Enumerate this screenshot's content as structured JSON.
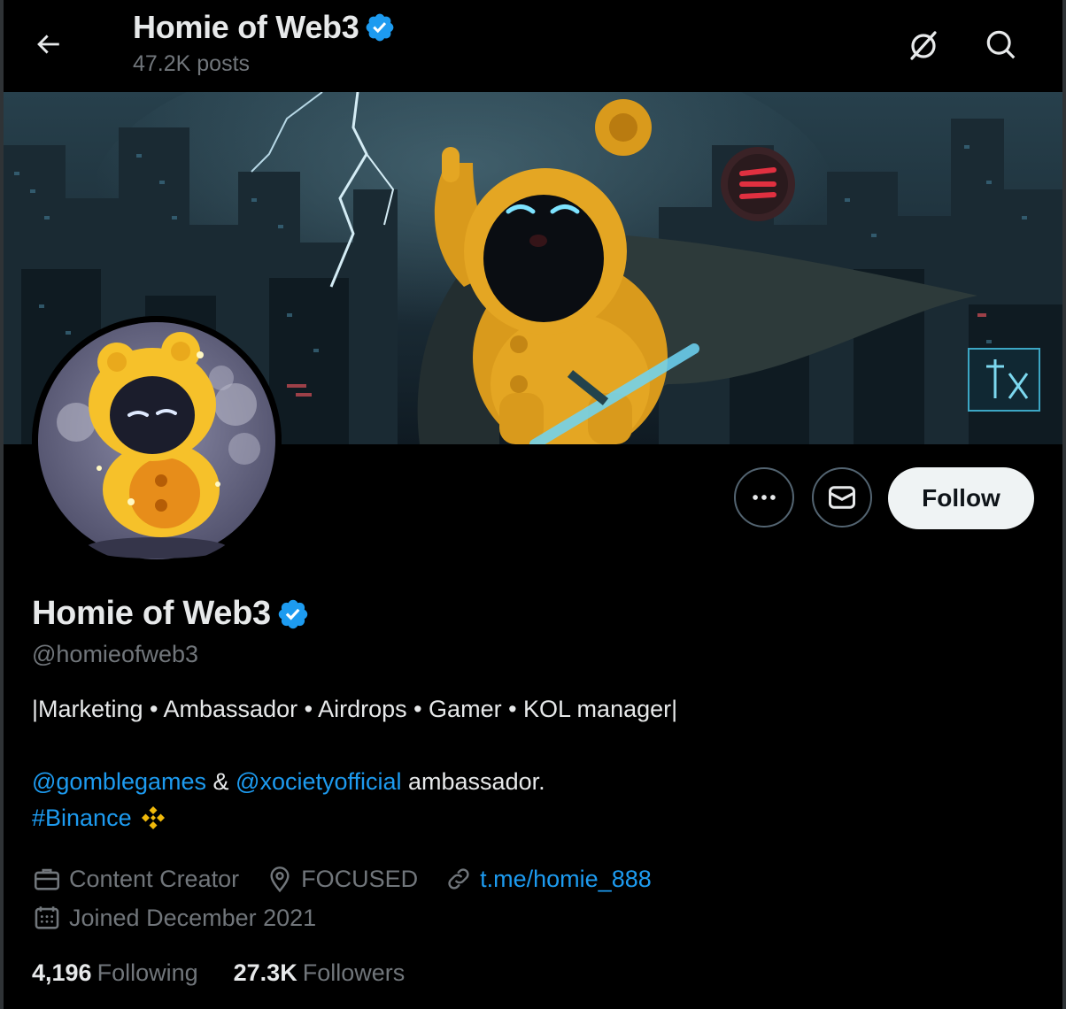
{
  "header": {
    "title": "Homie of Web3",
    "posts_count": "47.2K posts",
    "icons": [
      "back-arrow-icon",
      "grok-icon",
      "search-icon"
    ]
  },
  "profile": {
    "name": "Homie of Web3",
    "handle": "@homieofweb3",
    "verified_color": "#1d9bf0",
    "bio_line1": "|Marketing • Ambassador • Airdrops • Gamer • KOL manager|",
    "bio_mention1": "@gomblegames",
    "bio_amp": " & ",
    "bio_mention2": "@xocietyofficial",
    "bio_suffix": " ambassador.",
    "bio_hashtag": "#Binance",
    "category": "Content Creator",
    "location": "FOCUSED",
    "website": "t.me/homie_888",
    "joined": "Joined December 2021",
    "following_count": "4,196",
    "following_label": "Following",
    "followers_count": "27.3K",
    "followers_label": "Followers"
  },
  "actions": {
    "more_icon": "more-icon",
    "message_icon": "message-icon",
    "follow_label": "Follow"
  },
  "colors": {
    "accent": "#1d9bf0",
    "secondary_text": "#71767b",
    "binance": "#f0b90b"
  }
}
